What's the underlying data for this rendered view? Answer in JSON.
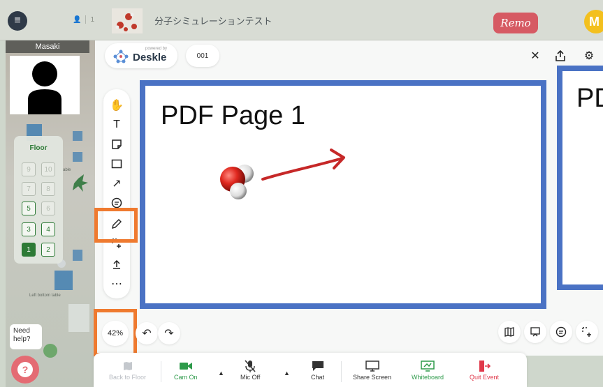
{
  "topbar": {
    "menu_icon": "hamburger-icon",
    "participant_count": "1",
    "event_title": "分子シミュレーションテスト",
    "brand": "Remo",
    "user_initial": "M",
    "colors": {
      "brand": "#d65a63",
      "avatar": "#f3c01e"
    }
  },
  "video": {
    "name": "Masaki"
  },
  "floor_panel": {
    "title": "Floor",
    "floors": [
      {
        "label": "9",
        "state": "inactive"
      },
      {
        "label": "10",
        "state": "inactive"
      },
      {
        "label": "7",
        "state": "inactive"
      },
      {
        "label": "8",
        "state": "inactive"
      },
      {
        "label": "5",
        "state": "active"
      },
      {
        "label": "6",
        "state": "inactive"
      },
      {
        "label": "3",
        "state": "active"
      },
      {
        "label": "4",
        "state": "active"
      },
      {
        "label": "1",
        "state": "current"
      },
      {
        "label": "2",
        "state": "active"
      }
    ],
    "table_labels": [
      "able",
      "Left bottom table"
    ]
  },
  "help": {
    "text": "Need help?",
    "icon": "?"
  },
  "whiteboard": {
    "powered_by": "powered by",
    "app_name": "Deskle",
    "page_number": "001",
    "zoom": "42%",
    "page1_title": "PDF Page 1",
    "page2_title": "PDF",
    "tools": [
      "hand-tool",
      "text-tool",
      "sticky-note-tool",
      "rectangle-tool",
      "arrow-tool",
      "comment-tool",
      "pen-tool",
      "selection-tool",
      "upload-tool",
      "more-tool"
    ],
    "selected_tool": "pen-tool",
    "colors": {
      "page_border": "#4a72c4",
      "highlight": "#ef7a2f",
      "arrow": "#c62828"
    }
  },
  "dock": {
    "items": [
      {
        "label": "Back to Floor",
        "icon": "map-icon",
        "state": "disabled"
      },
      {
        "label": "Cam On",
        "icon": "camera-icon",
        "state": "green"
      },
      {
        "label": "Mic Off",
        "icon": "mic-off-icon",
        "state": "normal"
      },
      {
        "label": "Chat",
        "icon": "chat-icon",
        "state": "normal"
      },
      {
        "label": "Share Screen",
        "icon": "screen-share-icon",
        "state": "normal"
      },
      {
        "label": "Whiteboard",
        "icon": "whiteboard-icon",
        "state": "green"
      },
      {
        "label": "Quit Event",
        "icon": "exit-icon",
        "state": "red"
      }
    ]
  }
}
